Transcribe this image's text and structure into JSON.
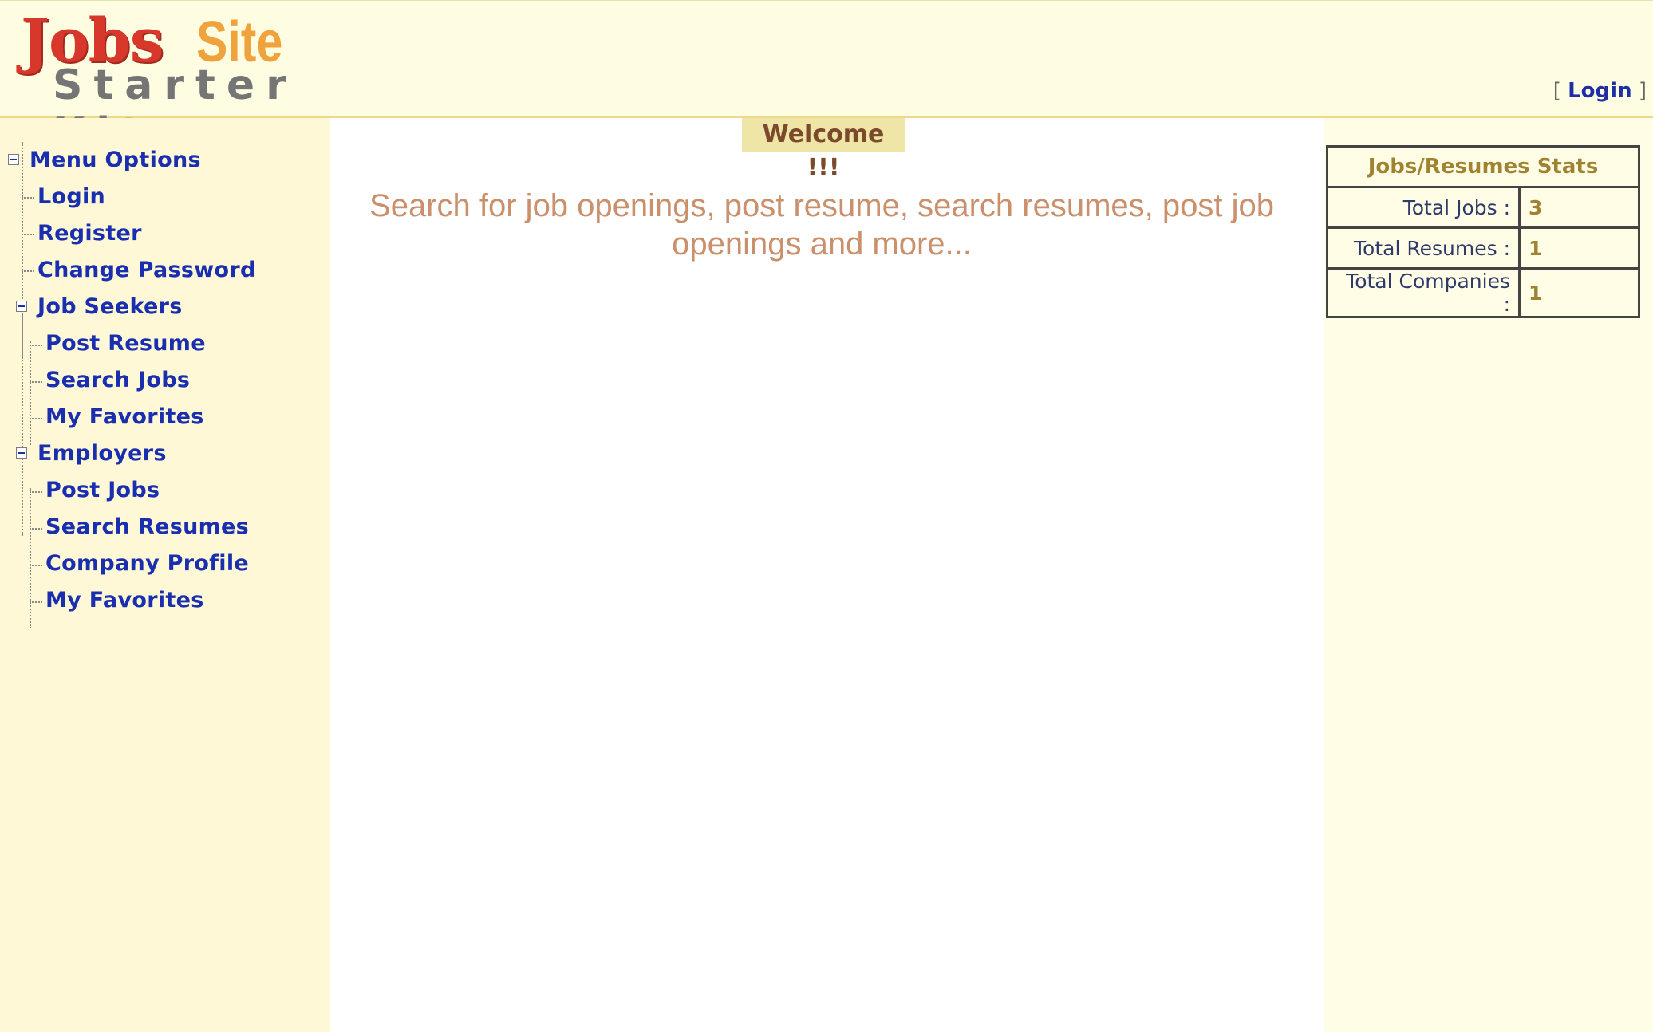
{
  "header": {
    "logo_jobs": "Jobs",
    "logo_site": "Site",
    "logo_kit": "Starter Kit",
    "login_open": "[",
    "login_label": "Login",
    "login_close": "]"
  },
  "sidebar": {
    "menu_options": "Menu Options",
    "items": {
      "login": "Login",
      "register": "Register",
      "change_password": "Change Password"
    },
    "job_seekers": {
      "label": "Job Seekers",
      "post_resume": "Post Resume",
      "search_jobs": "Search Jobs",
      "my_favorites": "My Favorites"
    },
    "employers": {
      "label": "Employers",
      "post_jobs": "Post Jobs",
      "search_resumes": "Search Resumes",
      "company_profile": "Company Profile",
      "my_favorites": "My Favorites"
    }
  },
  "main": {
    "welcome": "Welcome !!!",
    "tagline": "Search for job openings, post resume, search resumes, post job openings and more..."
  },
  "stats": {
    "title": "Jobs/Resumes Stats",
    "rows": [
      {
        "label": "Total Jobs :",
        "value": "3"
      },
      {
        "label": "Total Resumes :",
        "value": "1"
      },
      {
        "label": "Total Companies :",
        "value": "1"
      }
    ]
  },
  "colors": {
    "link": "#1a2fb0",
    "header_bg": "#fffde1",
    "sidebar_bg": "#fff8d6",
    "welcome_bg": "#efe5a6",
    "tagline": "#c9906b",
    "stat_value": "#a08330"
  }
}
